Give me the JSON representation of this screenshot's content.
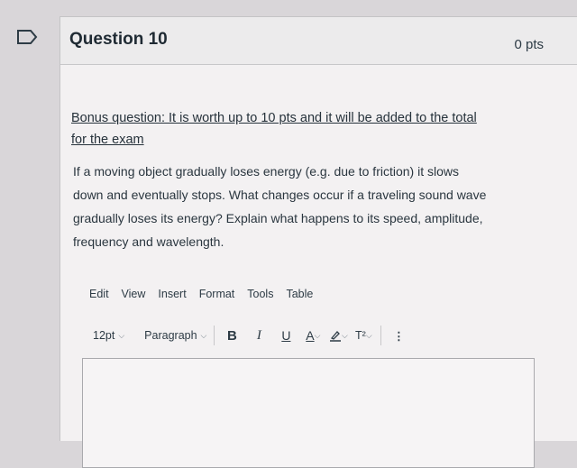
{
  "question": {
    "title": "Question 10",
    "points": "0 pts",
    "bonus_line1": "Bonus question: It is worth up to 10 pts and it will be added to the total",
    "bonus_line2": "for the exam",
    "body_line1": "If a moving object gradually loses energy (e.g. due to friction) it slows",
    "body_line2": "down and eventually stops. What changes occur if a traveling sound wave",
    "body_line3": "gradually loses its energy? Explain what happens to its speed, amplitude,",
    "body_line4": "frequency and wavelength."
  },
  "editor": {
    "menu": [
      "Edit",
      "View",
      "Insert",
      "Format",
      "Tools",
      "Table"
    ],
    "font_size": "12pt",
    "block_format": "Paragraph",
    "bold": "B",
    "italic": "I",
    "underline": "U",
    "text_color": "A",
    "superscript": "T²",
    "more": "⋮"
  },
  "icons": {
    "bookmark": "bookmark-icon",
    "highlight": "highlighter-icon"
  },
  "colors": {
    "text_color_swatch": "#2d3b45",
    "highlight_swatch": "#2d3b45"
  }
}
